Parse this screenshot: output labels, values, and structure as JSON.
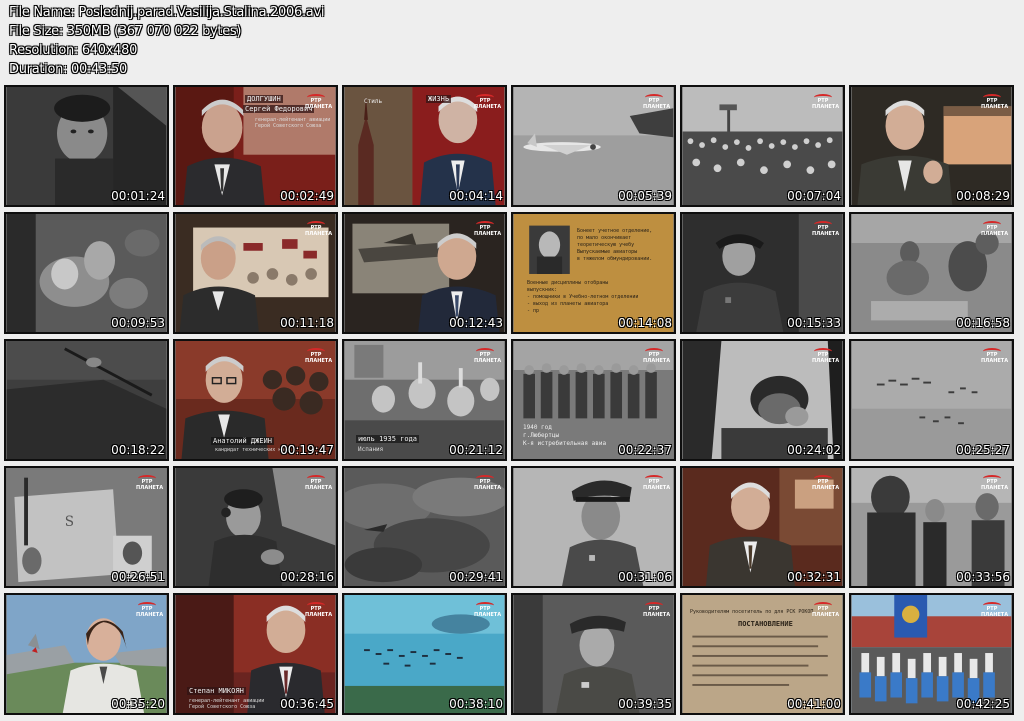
{
  "header": {
    "file_name": "File Name: Poslednij.parad.Vasilija.Stalina.2006.avi",
    "file_size": "File Size: 350MB (367 070 022 bytes)",
    "resolution": "Resolution: 640x480",
    "duration": "Duration: 00:43:50"
  },
  "channel_logo": "РТР ПЛАНЕТА",
  "thumbnails": [
    {
      "time": "00:01:24",
      "scene": "pilot-closeup"
    },
    {
      "time": "00:02:49",
      "scene": "interview-red-bg"
    },
    {
      "time": "00:04:14",
      "scene": "kremlin-tower-interview"
    },
    {
      "time": "00:05:39",
      "scene": "plane-in-sky"
    },
    {
      "time": "00:07:04",
      "scene": "crowd-airfield"
    },
    {
      "time": "00:08:29",
      "scene": "interview-gesture"
    },
    {
      "time": "00:09:53",
      "scene": "crowd-celebration"
    },
    {
      "time": "00:11:18",
      "scene": "interview-screen"
    },
    {
      "time": "00:12:43",
      "scene": "interview-plane-bg"
    },
    {
      "time": "00:14:08",
      "scene": "document-photo"
    },
    {
      "time": "00:15:33",
      "scene": "officer-portrait"
    },
    {
      "time": "00:16:58",
      "scene": "soldiers-field"
    },
    {
      "time": "00:18:22",
      "scene": "aircraft-wing"
    },
    {
      "time": "00:19:47",
      "scene": "interview-glasses"
    },
    {
      "time": "00:21:12",
      "scene": "crowd-waving"
    },
    {
      "time": "00:22:37",
      "scene": "pilots-lineup"
    },
    {
      "time": "00:24:02",
      "scene": "pilot-in-cockpit"
    },
    {
      "time": "00:25:27",
      "scene": "formation-flight"
    },
    {
      "time": "00:26:51",
      "scene": "photo-collage"
    },
    {
      "time": "00:28:16",
      "scene": "pilot-headset"
    },
    {
      "time": "00:29:41",
      "scene": "dark-clouds"
    },
    {
      "time": "00:31:06",
      "scene": "officer-cap"
    },
    {
      "time": "00:32:31",
      "scene": "interview-veteran"
    },
    {
      "time": "00:33:56",
      "scene": "parade-officers"
    },
    {
      "time": "00:35:20",
      "scene": "woman-pilot-color"
    },
    {
      "time": "00:36:45",
      "scene": "interview-mikoyan"
    },
    {
      "time": "00:38:10",
      "scene": "formation-blue-sky"
    },
    {
      "time": "00:39:35",
      "scene": "stalin-cap"
    },
    {
      "time": "00:41:00",
      "scene": "old-document"
    },
    {
      "time": "00:42:25",
      "scene": "red-square-parade"
    }
  ],
  "captions": {
    "t2_name": "ДОЛГУШИН",
    "t2_sub": "Сергей Федорович",
    "t2_desc1": "генерал-лейтенант авиации",
    "t2_desc2": "Герой Советского Союза",
    "t3_left": "Стиль",
    "t3_right": "ЖИЗНЬ",
    "t10_line1": "Бонеет учетное отделение,",
    "t10_line2": "по мало окончивает",
    "t10_line3": "теоретическую учебу",
    "t10_line4": "Выпускаемые авиаторы",
    "t10_line5": "в тяжелом обмундировании.",
    "t10_line6": "Военные дисциплины отобраны",
    "t10_line7": "выпускник:",
    "t10_line8": "- помощники в Учебно-летном отделении",
    "t10_line9": "- выход из планеты авиатора",
    "t10_line10": "- пр",
    "t14_name": "Анатолий ДЖЕИН",
    "t14_desc": "кандидат технических наук",
    "t15_cap": "июль 1935 года",
    "t15_place": "Испания",
    "t16_year": "1940 год",
    "t16_place": "г.Любертцы",
    "t16_unit": "К-я истребительная авиа",
    "t26_name": "Степан МИКОЯН",
    "t26_desc1": "генерал-лейтенант авиации",
    "t26_desc2": "Герой Советского Союза",
    "t29_head": "Руководителям посетитель по для РСК РОКОП",
    "t29_title": "ПОСТАНОВЛЕНИЕ"
  }
}
